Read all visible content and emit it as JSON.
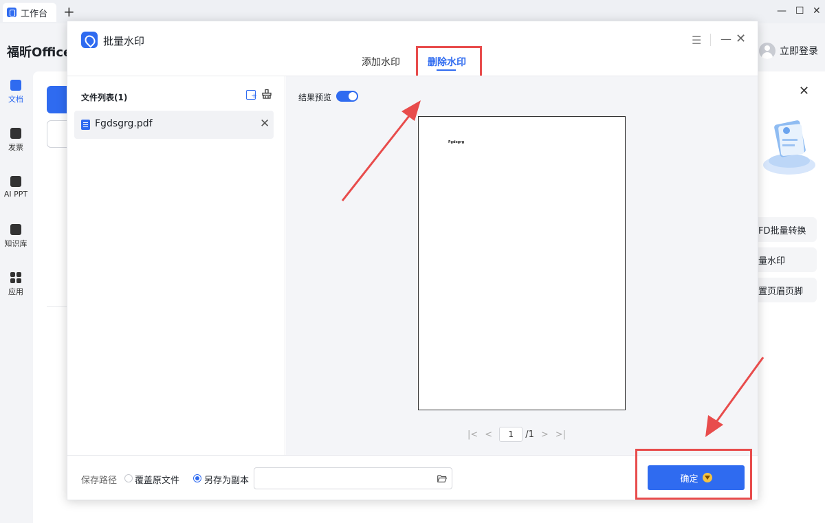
{
  "titlebar": {
    "tab_label": "工作台",
    "new_tab": "+",
    "minimize": "—",
    "maximize": "☐",
    "close": "✕"
  },
  "app": {
    "brand": "福昕Office",
    "login": "立即登录"
  },
  "leftnav": {
    "items": [
      {
        "label": "文档"
      },
      {
        "label": "发票"
      },
      {
        "label": "AI PPT"
      },
      {
        "label": "知识库"
      },
      {
        "label": "应用"
      }
    ]
  },
  "right_panel": {
    "buttons": [
      "FD批量转换",
      "量水印",
      "置页眉页脚"
    ]
  },
  "dialog": {
    "title": "批量水印",
    "tabs": {
      "add": "添加水印",
      "remove": "删除水印"
    },
    "file_list": {
      "title": "文件列表(1)",
      "files": [
        {
          "name": "Fgdsgrg.pdf"
        }
      ]
    },
    "preview": {
      "label": "结果预览",
      "toggle_on": true,
      "page_text": "Fgdsgrg",
      "page_current": "1",
      "page_total": "/1"
    },
    "footer": {
      "save_path_label": "保存路径",
      "option_overwrite": "覆盖原文件",
      "option_copy": "另存为副本",
      "selected_option": "另存为副本",
      "confirm": "确定"
    }
  },
  "colors": {
    "accent": "#2f6bf0",
    "annotation_red": "#e84c4c"
  }
}
